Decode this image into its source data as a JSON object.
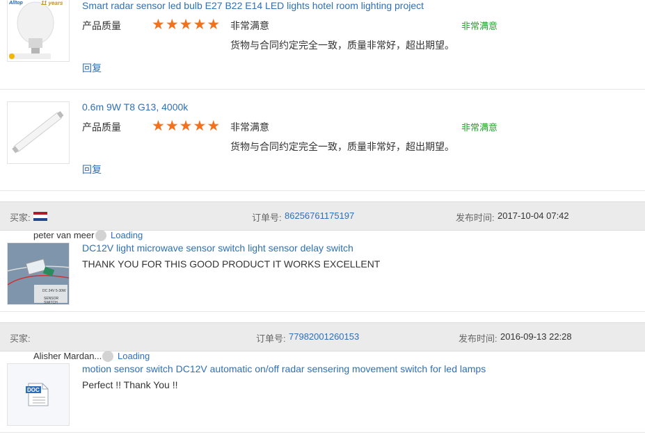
{
  "reviews_top": [
    {
      "product_title": "Smart radar sensor led bulb E27 B22 E14 LED lights hotel room lighting project",
      "rating_label": "产品质量",
      "rating_text": "非常满意",
      "comment": "货物与合同约定完全一致，质量非常好，超出期望。",
      "overall": "非常满意",
      "reply": "回复",
      "thumb_brand": "Alltop",
      "thumb_badge": "11 years"
    },
    {
      "product_title": "0.6m 9W T8 G13, 4000k",
      "rating_label": "产品质量",
      "rating_text": "非常满意",
      "comment": "货物与合同约定完全一致，质量非常好，超出期望。",
      "overall": "非常满意",
      "reply": "回复"
    }
  ],
  "orders": [
    {
      "buyer_label": "买家:",
      "order_label": "订单号:",
      "order_no": "86256761175197",
      "time_label": "发布时间:",
      "time": "2017-10-04 07:42",
      "buyer_name": "peter van meer",
      "loading": "Loading",
      "product_title": "DC12V light microwave sensor switch light sensor delay switch",
      "comment": "THANK YOU FOR THIS GOOD PRODUCT IT WORKS EXCELLENT",
      "thumb_text": "DC 24V 5-30W",
      "thumb_caption": "SENSOR SWITCH"
    },
    {
      "buyer_label": "买家:",
      "order_label": "订单号:",
      "order_no": "77982001260153",
      "time_label": "发布时间:",
      "time": "2016-09-13 22:28",
      "buyer_name": "Alisher Mardan...",
      "loading": "Loading",
      "product_title": "motion sensor switch DC12V automatic on/off radar sensering movement switch for led lamps",
      "comment": "Perfect !! Thank You !!",
      "doc_label": "DOC"
    }
  ],
  "colors": {
    "link": "#2e6fb6",
    "star": "#f2711c",
    "green": "#24a42d",
    "bar": "#ebebeb"
  },
  "flag": "netherlands-flag"
}
